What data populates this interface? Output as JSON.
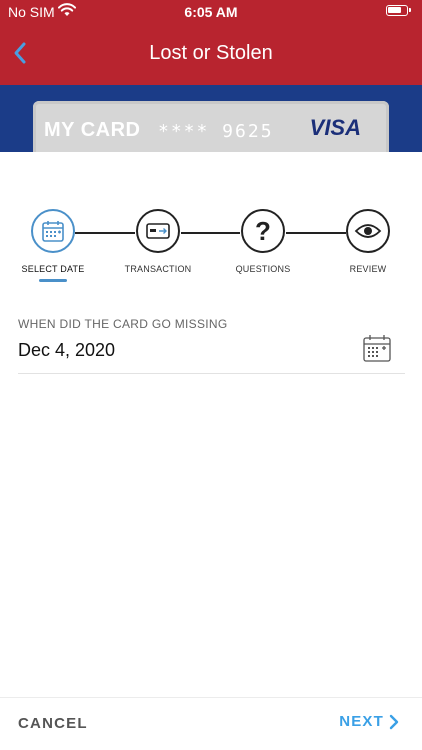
{
  "status_bar": {
    "carrier": "No SIM",
    "time": "6:05 AM"
  },
  "nav": {
    "title": "Lost or Stolen",
    "back_icon": "chevron-left-icon"
  },
  "card": {
    "label": "MY CARD",
    "masked_number": "**** 9625",
    "network": "VISA"
  },
  "steps": [
    {
      "label": "SELECT DATE",
      "icon": "calendar-icon",
      "active": true
    },
    {
      "label": "TRANSACTION",
      "icon": "credit-card-icon",
      "active": false
    },
    {
      "label": "QUESTIONS",
      "icon": "question-icon",
      "active": false
    },
    {
      "label": "REVIEW",
      "icon": "eye-icon",
      "active": false
    }
  ],
  "date_field": {
    "label": "WHEN DID THE CARD GO MISSING",
    "value": "Dec 4, 2020",
    "icon": "calendar-icon"
  },
  "footer": {
    "cancel_label": "CANCEL",
    "next_label": "NEXT"
  },
  "colors": {
    "header": "#b8242f",
    "banner": "#1b3c88",
    "accent": "#3aa0e6",
    "active_step": "#4a90c9"
  }
}
